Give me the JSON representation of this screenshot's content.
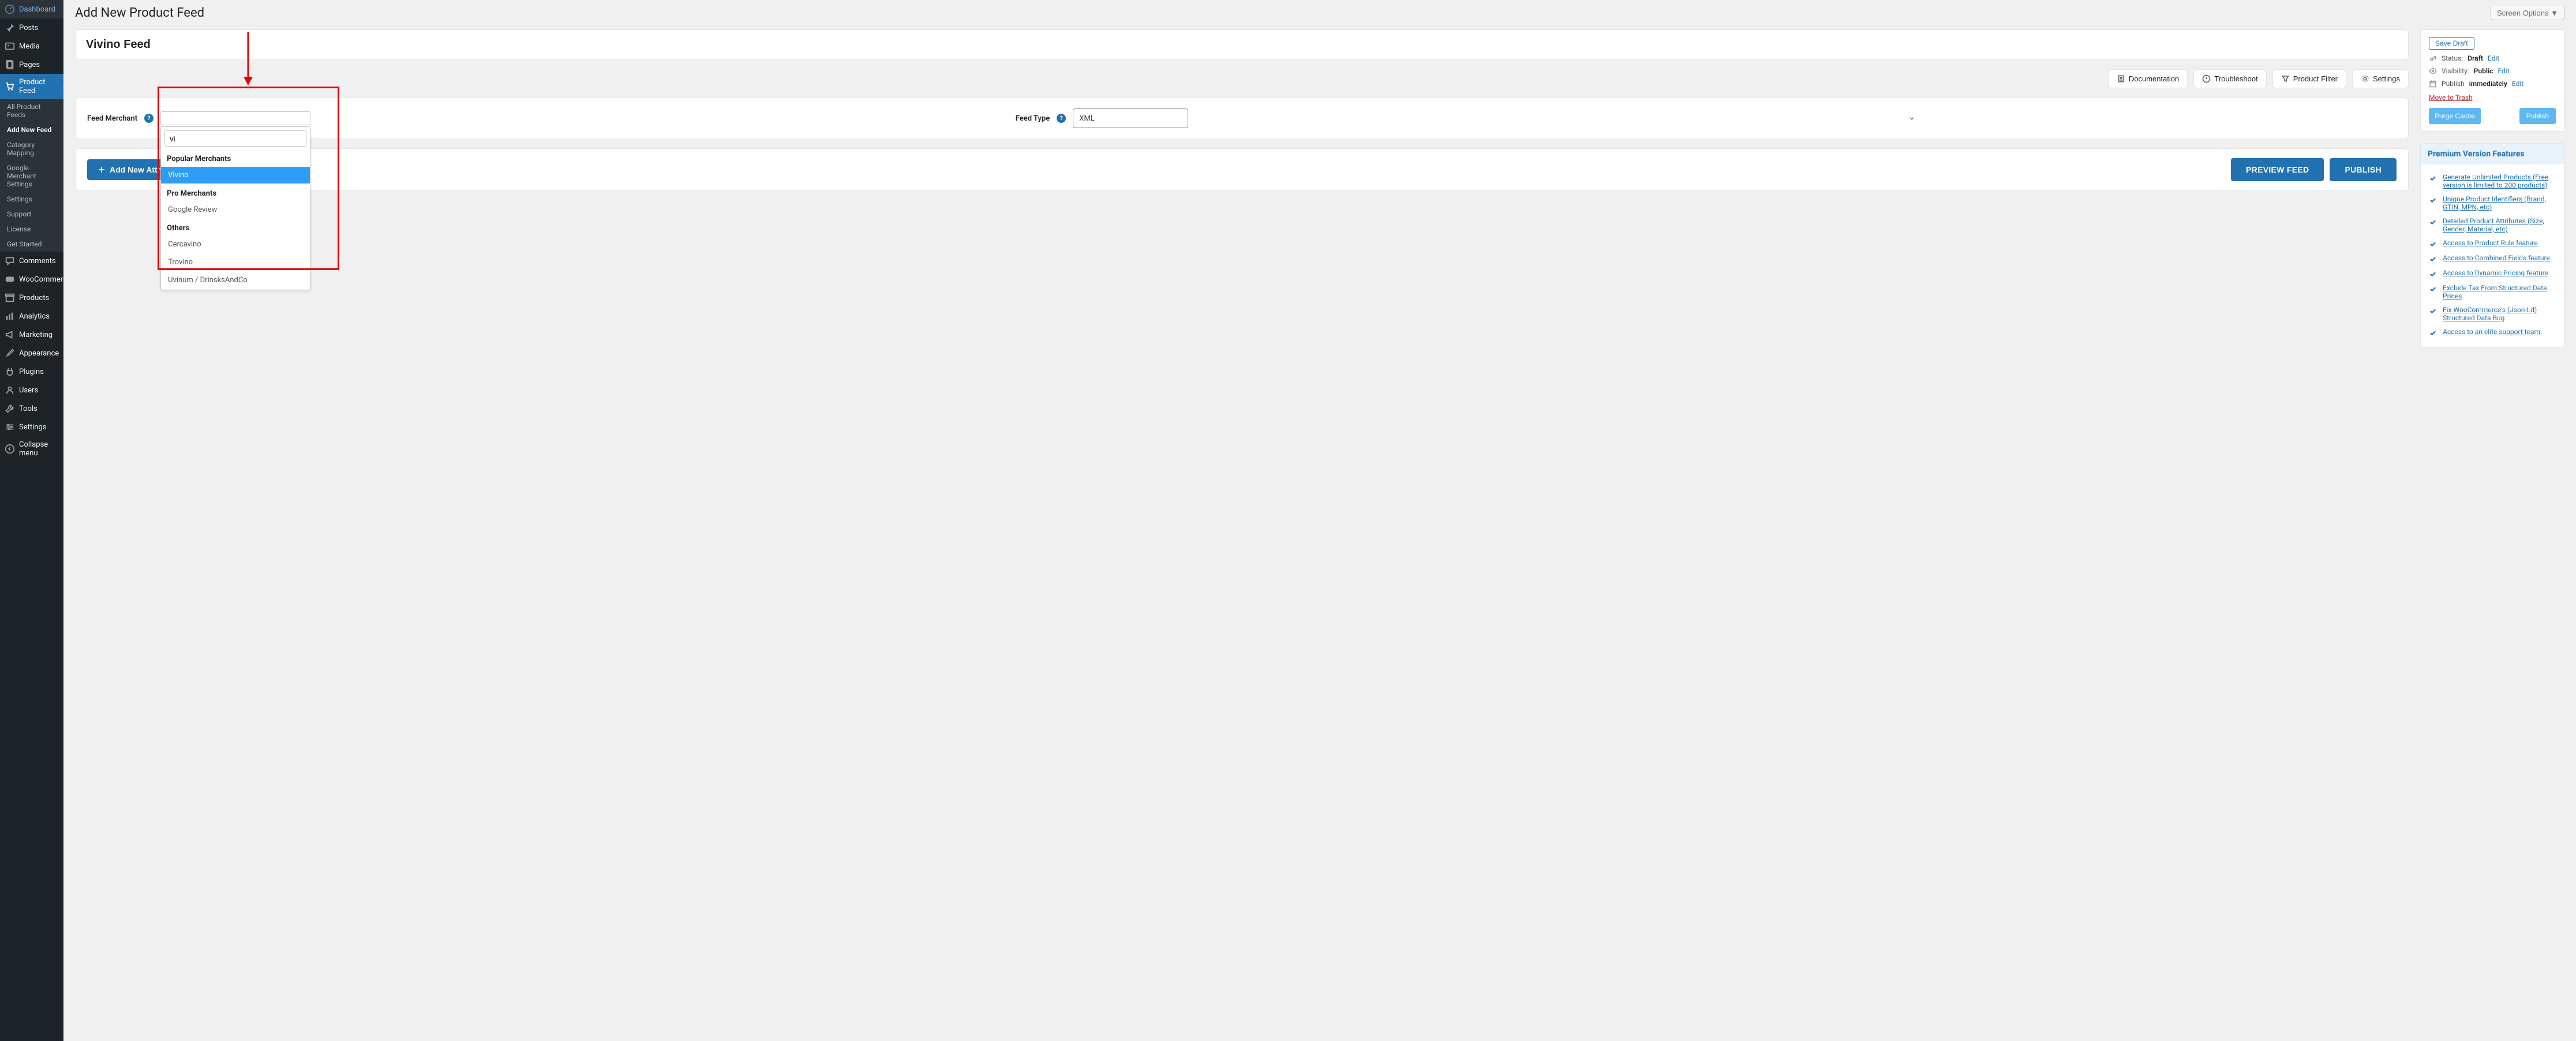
{
  "sidebar": {
    "items": [
      {
        "label": "Dashboard",
        "icon": "dashboard"
      },
      {
        "label": "Posts",
        "icon": "pin"
      },
      {
        "label": "Media",
        "icon": "media"
      },
      {
        "label": "Pages",
        "icon": "pages"
      },
      {
        "label": "Product Feed",
        "icon": "cart",
        "active": true
      },
      {
        "label": "Comments",
        "icon": "comment"
      },
      {
        "label": "WooCommerce",
        "icon": "woo"
      },
      {
        "label": "Products",
        "icon": "archive"
      },
      {
        "label": "Analytics",
        "icon": "analytics"
      },
      {
        "label": "Marketing",
        "icon": "megaphone"
      },
      {
        "label": "Appearance",
        "icon": "brush"
      },
      {
        "label": "Plugins",
        "icon": "plug"
      },
      {
        "label": "Users",
        "icon": "users"
      },
      {
        "label": "Tools",
        "icon": "tools"
      },
      {
        "label": "Settings",
        "icon": "settings"
      },
      {
        "label": "Collapse menu",
        "icon": "collapse"
      }
    ],
    "submenu": [
      {
        "label": "All Product Feeds"
      },
      {
        "label": "Add New Feed",
        "active": true
      },
      {
        "label": "Category Mapping"
      },
      {
        "label": "Google Merchant Settings"
      },
      {
        "label": "Settings"
      },
      {
        "label": "Support"
      },
      {
        "label": "License"
      },
      {
        "label": "Get Started"
      }
    ]
  },
  "header": {
    "page_title": "Add New Product Feed",
    "screen_options": "Screen Options ▼"
  },
  "feed": {
    "title": "Vivino Feed",
    "merchant_label": "Feed Merchant",
    "feed_type_label": "Feed Type",
    "feed_type_value": "XML",
    "search_value": "vi"
  },
  "merchant_dropdown": {
    "groups": [
      {
        "label": "Popular Merchants",
        "options": [
          {
            "label": "Vivino",
            "highlighted": true
          }
        ]
      },
      {
        "label": "Pro Merchants",
        "options": [
          {
            "label": "Google Review"
          }
        ]
      },
      {
        "label": "Others",
        "options": [
          {
            "label": "Cercavino"
          },
          {
            "label": "Trovino"
          },
          {
            "label": "Uvinum / DrinsksAndCo"
          }
        ]
      }
    ]
  },
  "top_buttons": {
    "documentation": "Documentation",
    "troubleshoot": "Troubleshoot",
    "product_filter": "Product Filter",
    "settings": "Settings"
  },
  "actions": {
    "add_attribute": "Add New Attribute",
    "preview": "PREVIEW FEED",
    "publish": "PUBLISH"
  },
  "publish_box": {
    "save_draft": "Save Draft",
    "status_label": "Status:",
    "status_value": "Draft",
    "visibility_label": "Visibility:",
    "visibility_value": "Public",
    "publish_label": "Publish",
    "publish_value": "immediately",
    "edit_link": "Edit",
    "trash": "Move to Trash",
    "purge": "Purge Cache",
    "publish_btn": "Publish"
  },
  "premium": {
    "title": "Premium Version Features",
    "features": [
      "Generate Unlimited Products (Free version is limited to 200 products)",
      "Unique Product Identifiers (Brand, GTIN, MPN, etc)",
      "Detailed Product Attributes (Size, Gender, Material, etc)",
      "Access to Product Rule feature",
      "Access to Combined Fields feature",
      "Access to Dynamic Pricing feature",
      "Exclude Tax From Structured Data Prices",
      "Fix WooCommerce's (Json-Ld) Structured Data Bug",
      "Access to an elite support team."
    ]
  }
}
